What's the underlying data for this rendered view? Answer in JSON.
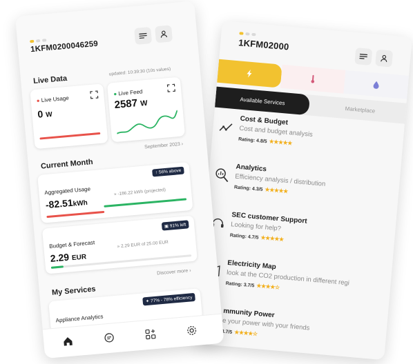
{
  "right_phone": {
    "device_id": "1KFM02000",
    "tabs": [
      {
        "icon": "bolt-icon"
      },
      {
        "icon": "thermometer-icon"
      },
      {
        "icon": "drop-icon"
      }
    ],
    "segments": {
      "active": "Available Services",
      "inactive": "Marketplace"
    },
    "services": [
      {
        "title": "Cost & Budget",
        "desc": "Cost and budget analysis",
        "rating": "Rating: 4.8/5",
        "icon": "trend-line-icon"
      },
      {
        "title": "Analytics",
        "desc": "Efficiency analysis / distribution",
        "rating": "Rating: 4.3/5",
        "icon": "analytics-search-icon"
      },
      {
        "title": "SEC customer Support",
        "desc": "Looking for help?",
        "rating": "Rating: 4.7/5",
        "icon": "support-icon"
      },
      {
        "title": "Electricity Map",
        "desc": "look at the CO2 production in different regi",
        "rating": "Rating: 3.7/5",
        "icon": "map-icon"
      },
      {
        "title": "mmunity Power",
        "desc": "e your power with your friends",
        "rating": "3.7/5",
        "icon": "community-icon"
      }
    ],
    "colors": {
      "accent": "#f2c230"
    }
  },
  "left_phone": {
    "device_id": "1KFM0200046259",
    "live": {
      "title": "Live Data",
      "updated": "updated: 10:39:30 (10s values)"
    },
    "live_usage": {
      "label": "Live Usage",
      "value": "0",
      "unit": "W"
    },
    "live_feed": {
      "label": "Live Feed",
      "value": "2587",
      "unit": "W"
    },
    "month_link": "September 2023",
    "current_month": {
      "title": "Current Month"
    },
    "aggregated": {
      "label": "Aggregated Usage",
      "value": "-82.51",
      "unit": "kWh",
      "projected": "-186.22 kWh (projected)",
      "badge": "56% above"
    },
    "budget": {
      "label": "Budget & Forecast",
      "value": "2.29",
      "unit": "EUR",
      "of_text": "2.29 EUR of 25.00 EUR",
      "badge": "91% left"
    },
    "discover": "Discover more",
    "services": {
      "title": "My Services",
      "item": "Appliance Analytics",
      "badge": "77% - 78% efficiency"
    },
    "nav": [
      {
        "icon": "home-icon"
      },
      {
        "icon": "chat-icon"
      },
      {
        "icon": "apps-add-icon"
      },
      {
        "icon": "settings-icon"
      }
    ],
    "colors": {
      "red": "#e8524a",
      "green": "#2bb463",
      "navy": "#1f2a44"
    }
  }
}
